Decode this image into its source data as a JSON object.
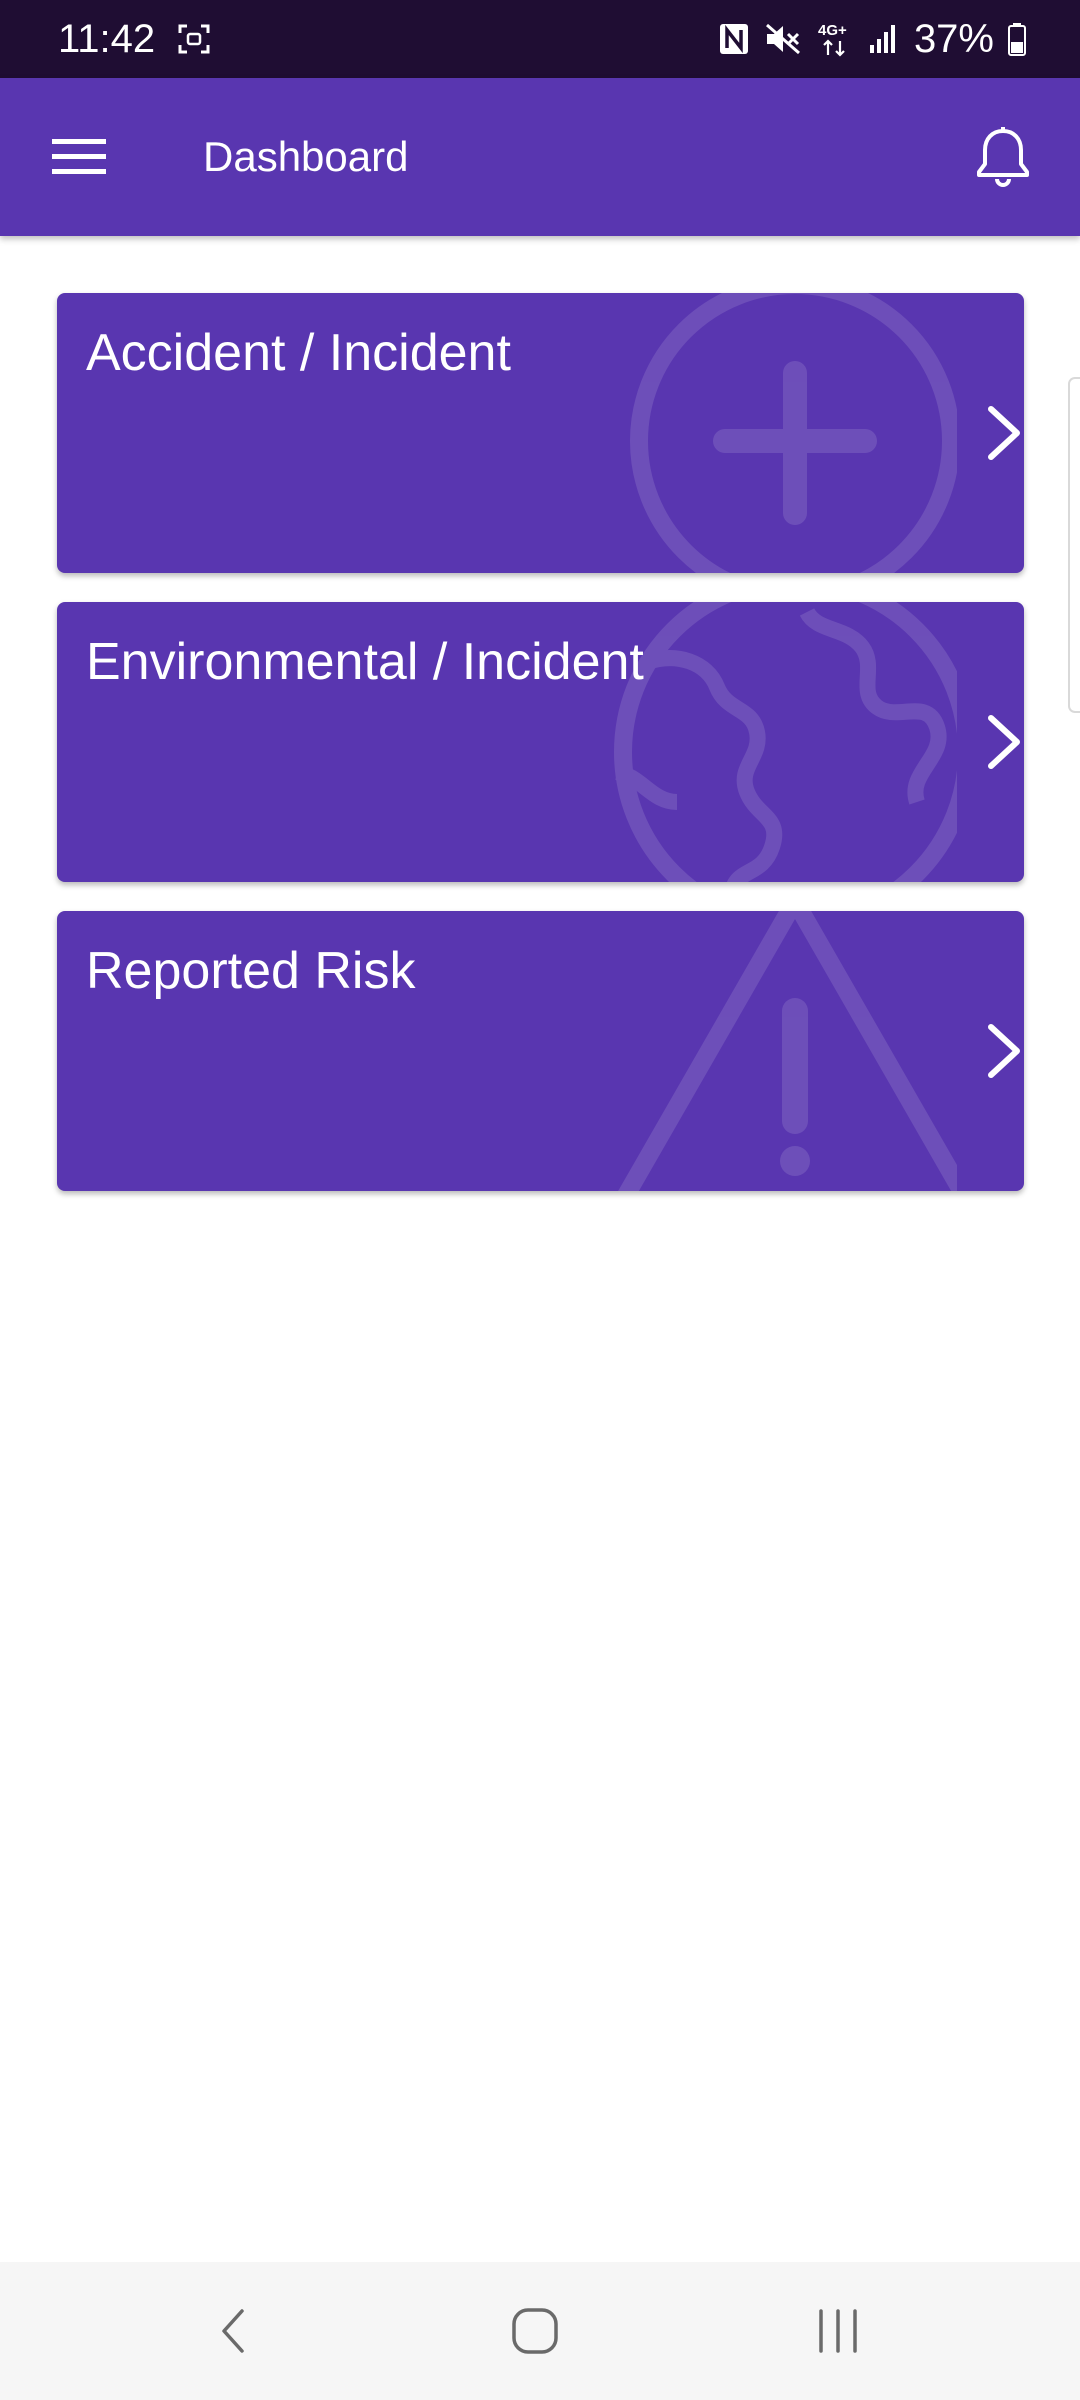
{
  "status_bar": {
    "time": "11:42",
    "battery": "37%",
    "network": "4G+",
    "icons": [
      "screenshot-icon",
      "nfc-icon",
      "mute-icon",
      "data-icon",
      "signal-icon",
      "battery-icon"
    ]
  },
  "app_bar": {
    "title": "Dashboard",
    "menu_icon": "hamburger-menu-icon",
    "notification_icon": "bell-icon"
  },
  "cards": [
    {
      "title": "Accident / Incident",
      "background_icon": "plus-circle-icon"
    },
    {
      "title": "Environmental / Incident",
      "background_icon": "globe-icon"
    },
    {
      "title": "Reported Risk",
      "background_icon": "warning-triangle-icon"
    }
  ],
  "nav_bar": {
    "buttons": [
      "back-icon",
      "home-icon",
      "recents-icon"
    ]
  },
  "colors": {
    "primary": "#5936b0",
    "status_bar": "#1f0d33",
    "background": "#ffffff",
    "nav_bar": "#f6f6f6"
  }
}
